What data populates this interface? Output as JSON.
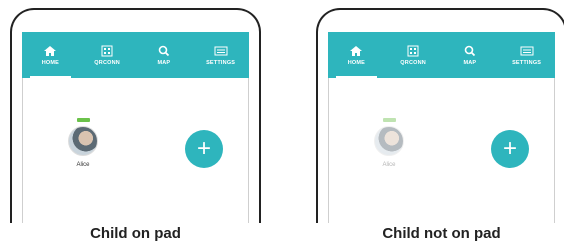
{
  "screens": [
    {
      "tabs": [
        {
          "label": "HOME",
          "icon": "home-icon",
          "active": true
        },
        {
          "label": "QRCONN",
          "icon": "qr-code-icon",
          "active": false
        },
        {
          "label": "MAP",
          "icon": "search-icon",
          "active": false
        },
        {
          "label": "SETTINGS",
          "icon": "keyboard-icon",
          "active": false
        }
      ],
      "child": {
        "name": "Alice",
        "on_pad": true
      },
      "add_button_label": "+",
      "caption": "Child on pad"
    },
    {
      "tabs": [
        {
          "label": "HOME",
          "icon": "home-icon",
          "active": true
        },
        {
          "label": "QRCONN",
          "icon": "qr-code-icon",
          "active": false
        },
        {
          "label": "MAP",
          "icon": "search-icon",
          "active": false
        },
        {
          "label": "SETTINGS",
          "icon": "keyboard-icon",
          "active": false
        }
      ],
      "child": {
        "name": "Alice",
        "on_pad": false
      },
      "add_button_label": "+",
      "caption": "Child not on pad"
    }
  ],
  "colors": {
    "accent": "#2eb5bd",
    "battery": "#6bc24a",
    "frame": "#222222"
  }
}
